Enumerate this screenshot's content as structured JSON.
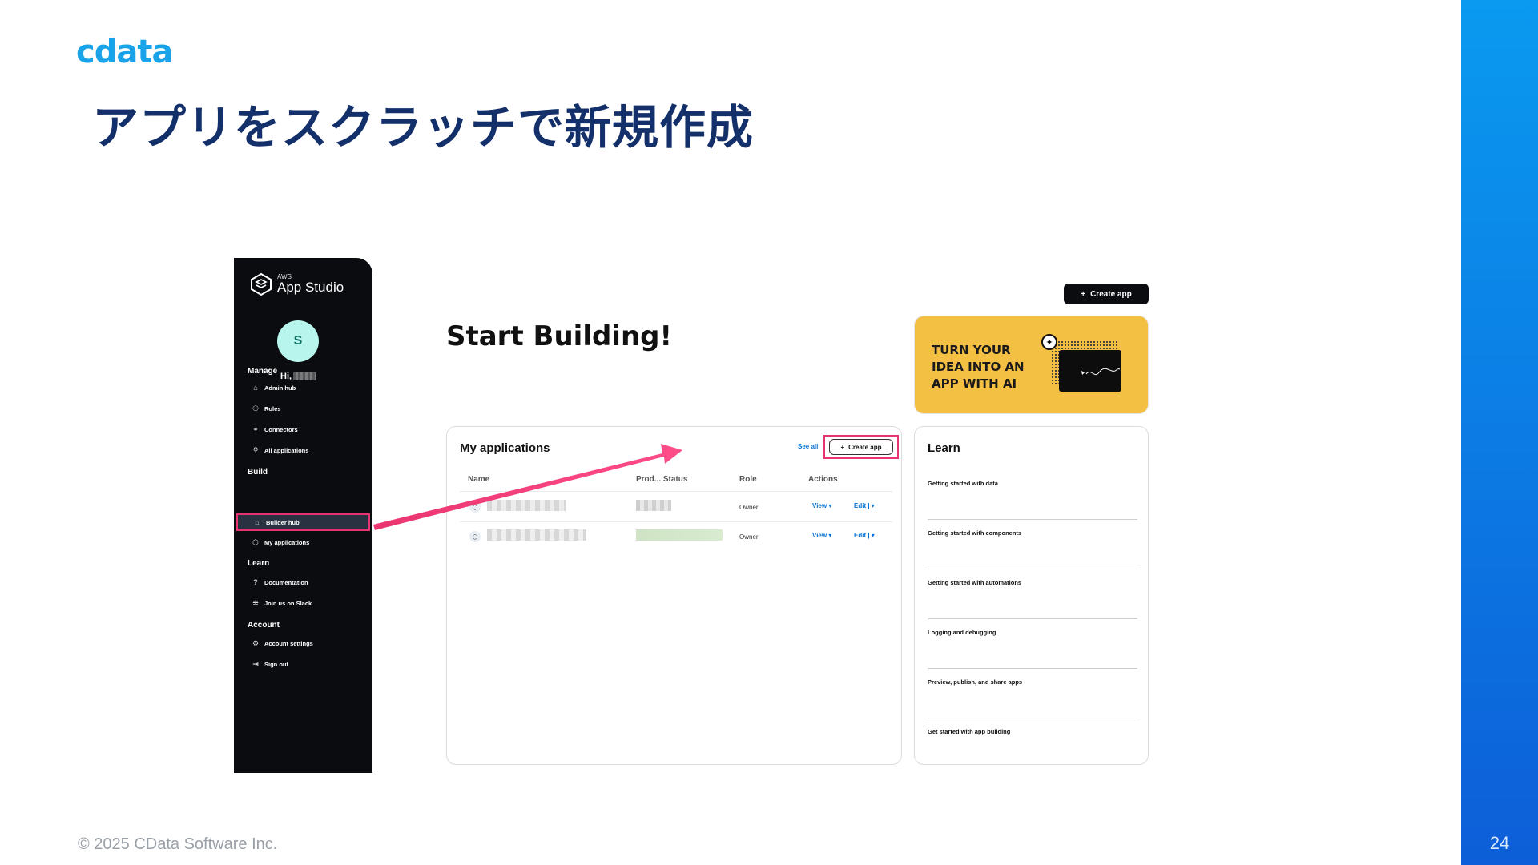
{
  "slide": {
    "logo": "cdata",
    "title": "アプリをスクラッチで新規作成",
    "copyright": "© 2025 CData Software Inc.",
    "page_number": "24"
  },
  "colors": {
    "accent_pink": "#e9356f",
    "title_navy": "#14306b",
    "band_blue": "#0a9af0",
    "logo_blue": "#1aa3e8"
  },
  "app": {
    "brand_small": "AWS",
    "brand_name": "App Studio",
    "avatar_letter": "S",
    "greeting": "Hi,",
    "sections": {
      "manage": "Manage",
      "build": "Build",
      "learn": "Learn",
      "account": "Account"
    },
    "nav": {
      "admin_hub": "Admin hub",
      "roles": "Roles",
      "connectors": "Connectors",
      "all_applications": "All applications",
      "builder_hub": "Builder hub",
      "my_applications": "My applications",
      "documentation": "Documentation",
      "join_slack": "Join us on Slack",
      "account_settings": "Account settings",
      "sign_out": "Sign out"
    },
    "start_title": "Start Building!",
    "create_app": "Create app",
    "ai_banner": "TURN YOUR\nIDEA INTO AN\nAPP WITH AI",
    "my_apps": {
      "title": "My applications",
      "see_all": "See all",
      "create_app": "Create app",
      "columns": {
        "name": "Name",
        "prod_status": "Prod... Status",
        "role": "Role",
        "actions": "Actions"
      },
      "rows": [
        {
          "role": "Owner",
          "view": "View",
          "edit": "Edit"
        },
        {
          "role": "Owner",
          "view": "View",
          "edit": "Edit"
        }
      ]
    },
    "learn": {
      "title": "Learn",
      "items": [
        "Getting started with data",
        "Getting started with components",
        "Getting started with automations",
        "Logging and debugging",
        "Preview, publish, and share apps",
        "Get started with app building"
      ]
    }
  }
}
